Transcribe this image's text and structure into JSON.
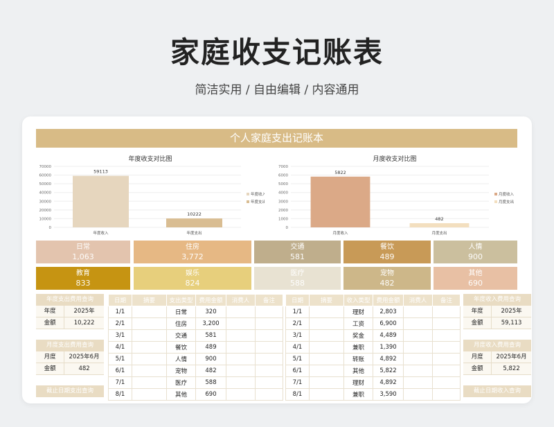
{
  "hero": {
    "title": "家庭收支记账表",
    "subtitle": "简洁实用 / 自由编辑 / 内容通用"
  },
  "banner": "个人家庭支出记账本",
  "charts": {
    "annual": {
      "title": "年度收支对比图",
      "y_ticks": [
        "70000",
        "60000",
        "50000",
        "40000",
        "30000",
        "20000",
        "10000",
        "0"
      ],
      "categories": [
        "年度收入",
        "年度支出"
      ],
      "values": [
        59113,
        10222
      ],
      "value_labels": [
        "59113",
        "10222"
      ],
      "legend": [
        "年度收入",
        "年度支出"
      ],
      "colors": [
        "#e6d6be",
        "#d9bd92"
      ],
      "ylim": [
        0,
        70000
      ]
    },
    "monthly": {
      "title": "月度收支对比图",
      "y_ticks": [
        "7000",
        "6000",
        "5000",
        "4000",
        "3000",
        "2000",
        "1000",
        "0"
      ],
      "categories": [
        "月度收入",
        "月度支出"
      ],
      "values": [
        5822,
        482
      ],
      "value_labels": [
        "5822",
        "482"
      ],
      "legend": [
        "月度收入",
        "月度支出"
      ],
      "colors": [
        "#dba987",
        "#f3dfbf"
      ],
      "ylim": [
        0,
        7000
      ]
    }
  },
  "chart_data": [
    {
      "type": "bar",
      "title": "年度收支对比图",
      "categories": [
        "年度收入",
        "年度支出"
      ],
      "values": [
        59113,
        10222
      ],
      "ylim": [
        0,
        70000
      ],
      "legend": "right"
    },
    {
      "type": "bar",
      "title": "月度收支对比图",
      "categories": [
        "月度收入",
        "月度支出"
      ],
      "values": [
        5822,
        482
      ],
      "ylim": [
        0,
        7000
      ],
      "legend": "right"
    }
  ],
  "tiles": [
    {
      "label": "日常",
      "value": "1,063",
      "color": "#e3c4ae"
    },
    {
      "label": "住房",
      "value": "3,772",
      "color": "#e6b884"
    },
    {
      "label": "交通",
      "value": "581",
      "color": "#bfae8c"
    },
    {
      "label": "餐饮",
      "value": "489",
      "color": "#c89a57"
    },
    {
      "label": "人情",
      "value": "900",
      "color": "#cbbf9e"
    },
    {
      "label": "教育",
      "value": "833",
      "color": "#c69412"
    },
    {
      "label": "娱乐",
      "value": "824",
      "color": "#e7cf7c"
    },
    {
      "label": "医疗",
      "value": "588",
      "color": "#e8e2d2"
    },
    {
      "label": "宠物",
      "value": "482",
      "color": "#cdb789"
    },
    {
      "label": "其他",
      "value": "690",
      "color": "#e8c0a4"
    }
  ],
  "left_panels": [
    {
      "title": "年度支出费用查询",
      "rows": [
        {
          "k": "年度",
          "v": "2025年"
        },
        {
          "k": "金额",
          "v": "10,222"
        }
      ]
    },
    {
      "title": "月度支出费用查询",
      "rows": [
        {
          "k": "月度",
          "v": "2025年6月"
        },
        {
          "k": "金额",
          "v": "482"
        }
      ]
    },
    {
      "title": "截止日期支出查询",
      "rows": []
    }
  ],
  "right_panels": [
    {
      "title": "年度收入费用查询",
      "rows": [
        {
          "k": "年度",
          "v": "2025年"
        },
        {
          "k": "金额",
          "v": "59,113"
        }
      ]
    },
    {
      "title": "月度收入费用查询",
      "rows": [
        {
          "k": "月度",
          "v": "2025年6月"
        },
        {
          "k": "金额",
          "v": "5,822"
        }
      ]
    },
    {
      "title": "截止日期收入查询",
      "rows": []
    }
  ],
  "expense_table": {
    "headers": [
      "日期",
      "摘要",
      "支出类型",
      "费用金额",
      "消费人",
      "备注"
    ],
    "rows": [
      [
        "1/1",
        "",
        "日常",
        "320",
        "",
        ""
      ],
      [
        "2/1",
        "",
        "住房",
        "3,200",
        "",
        ""
      ],
      [
        "3/1",
        "",
        "交通",
        "581",
        "",
        ""
      ],
      [
        "4/1",
        "",
        "餐饮",
        "489",
        "",
        ""
      ],
      [
        "5/1",
        "",
        "人情",
        "900",
        "",
        ""
      ],
      [
        "6/1",
        "",
        "宠物",
        "482",
        "",
        ""
      ],
      [
        "7/1",
        "",
        "医疗",
        "588",
        "",
        ""
      ],
      [
        "8/1",
        "",
        "其他",
        "690",
        "",
        ""
      ]
    ]
  },
  "income_table": {
    "headers": [
      "日期",
      "摘要",
      "收入类型",
      "费用金额",
      "消费人",
      "备注"
    ],
    "rows": [
      [
        "1/1",
        "",
        "理财",
        "2,803",
        "",
        ""
      ],
      [
        "2/1",
        "",
        "工资",
        "6,900",
        "",
        ""
      ],
      [
        "3/1",
        "",
        "奖金",
        "4,489",
        "",
        ""
      ],
      [
        "4/1",
        "",
        "兼职",
        "1,390",
        "",
        ""
      ],
      [
        "5/1",
        "",
        "转账",
        "4,892",
        "",
        ""
      ],
      [
        "6/1",
        "",
        "其他",
        "5,822",
        "",
        ""
      ],
      [
        "7/1",
        "",
        "理财",
        "4,892",
        "",
        ""
      ],
      [
        "8/1",
        "",
        "兼职",
        "3,590",
        "",
        ""
      ]
    ]
  }
}
